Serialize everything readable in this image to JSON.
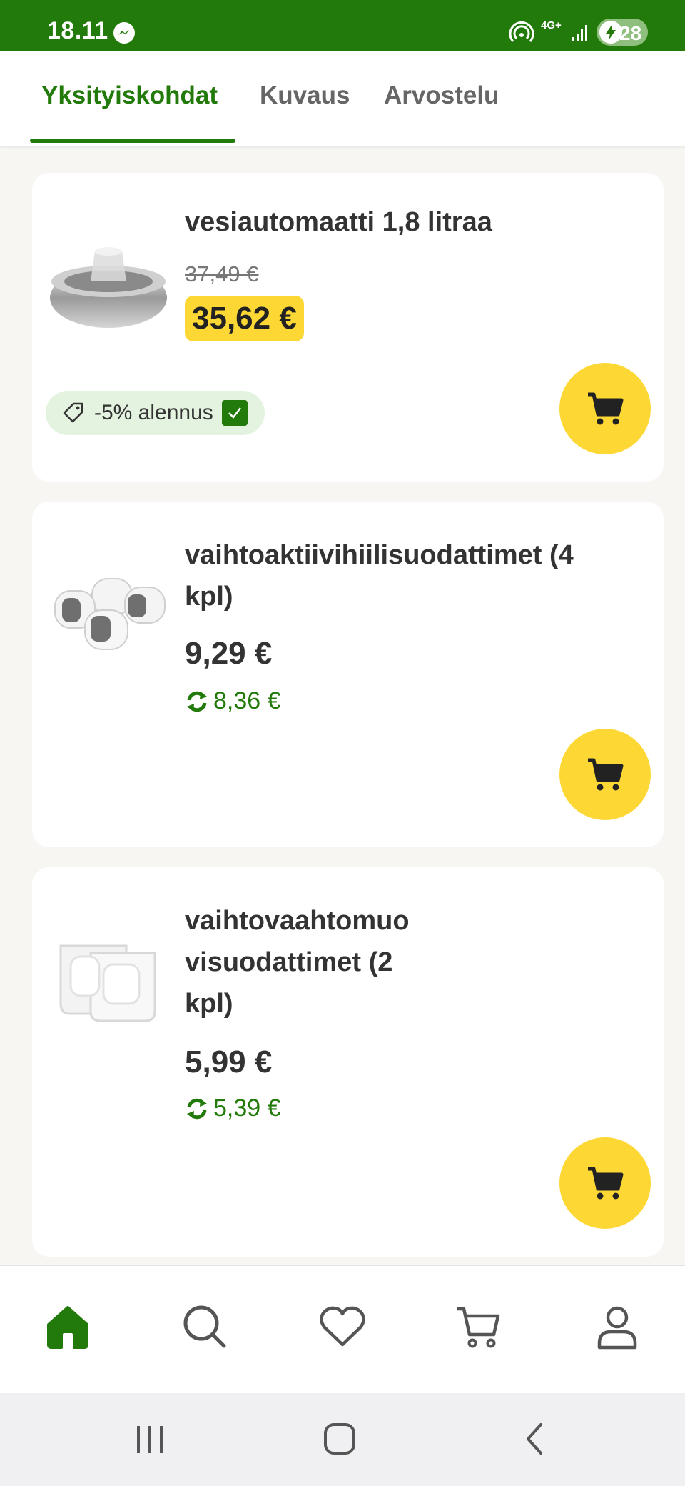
{
  "status": {
    "time": "18.11",
    "network": "4G+",
    "battery": "28"
  },
  "tabs": [
    {
      "label": "Yksityiskohdat",
      "active": true
    },
    {
      "label": "Kuvaus",
      "active": false
    },
    {
      "label": "Arvostelu",
      "active": false
    }
  ],
  "products": [
    {
      "title": "vesiautomaatti 1,8 litraa",
      "old_price": "37,49 €",
      "price": "35,62 €",
      "discount_label": "-5% alennus"
    },
    {
      "title": "vaihtoaktiivihiilisuodattimet (4 kpl)",
      "price": "9,29 €",
      "subscription_price": "8,36 €"
    },
    {
      "title": "vaihtovaahtomuo visuodattimet (2 kpl)",
      "price": "5,99 €",
      "subscription_price": "5,39 €"
    }
  ],
  "colors": {
    "brand_green": "#217a09",
    "accent_yellow": "#fdd835",
    "discount_bg": "#e3f3df"
  },
  "icons": {
    "nav": [
      "home-icon",
      "search-icon",
      "heart-icon",
      "cart-icon",
      "profile-icon"
    ],
    "system": [
      "recent-apps-icon",
      "home-button-icon",
      "back-icon"
    ]
  }
}
